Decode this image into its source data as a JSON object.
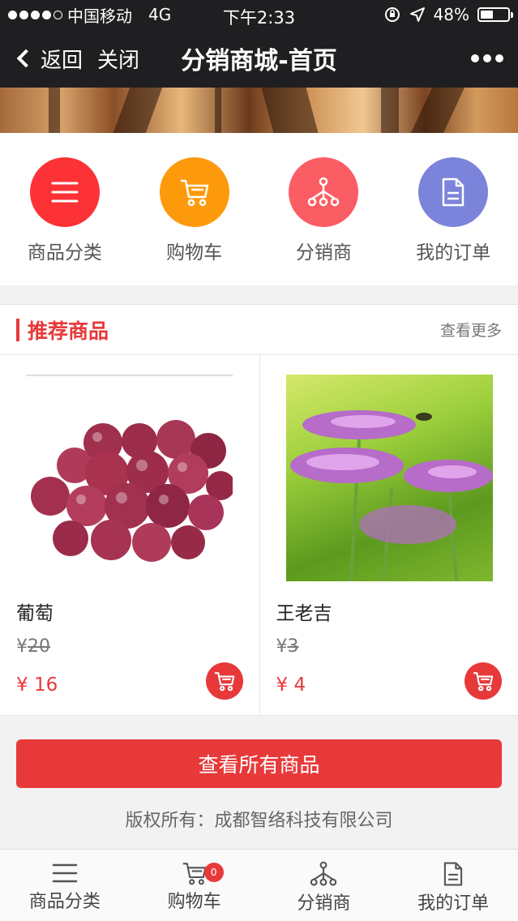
{
  "status_bar": {
    "carrier": "中国移动",
    "network": "4G",
    "time": "下午2:33",
    "battery": "48%",
    "battery_level": 0.48
  },
  "nav": {
    "back_label": "返回",
    "close_label": "关闭",
    "title": "分销商城-首页"
  },
  "shortcuts": [
    {
      "label": "商品分类",
      "icon": "menu-icon",
      "color": "#fc3236"
    },
    {
      "label": "购物车",
      "icon": "cart-icon",
      "color": "#fd9a0c"
    },
    {
      "label": "分销商",
      "icon": "network-icon",
      "color": "#fb5d64"
    },
    {
      "label": "我的订单",
      "icon": "document-icon",
      "color": "#7c83da"
    }
  ],
  "recommended": {
    "title": "推荐商品",
    "more_label": "查看更多",
    "products": [
      {
        "name": "葡萄",
        "currency": "¥",
        "old_price": "20",
        "price": "16"
      },
      {
        "name": "王老吉",
        "currency": "¥",
        "old_price": "3",
        "price": "4"
      }
    ]
  },
  "all_button": "查看所有商品",
  "copyright": "版权所有：成都智络科技有限公司",
  "tabbar": {
    "items": [
      {
        "label": "商品分类",
        "icon": "menu-icon"
      },
      {
        "label": "购物车",
        "icon": "cart-icon",
        "badge": "0"
      },
      {
        "label": "分销商",
        "icon": "network-icon"
      },
      {
        "label": "我的订单",
        "icon": "document-icon"
      }
    ]
  },
  "colors": {
    "accent": "#e8393a",
    "navbar": "#1f1f21"
  }
}
